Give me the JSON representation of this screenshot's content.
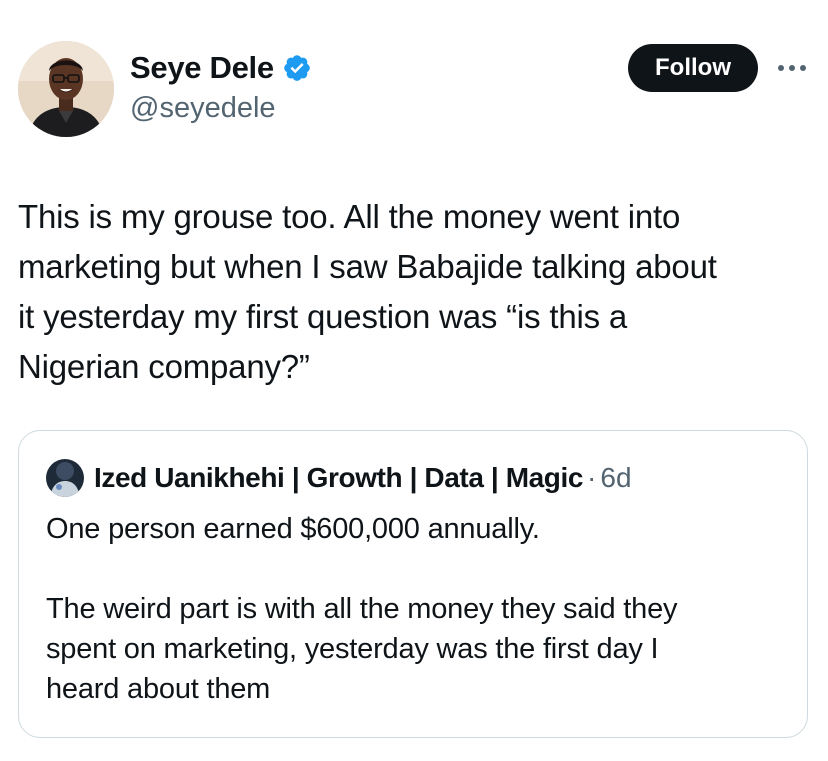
{
  "tweet": {
    "author": {
      "name": "Seye Dele",
      "handle": "@seyedele",
      "verified": true
    },
    "follow_label": "Follow",
    "more_icon": "more-horizontal-icon",
    "text": "This is my grouse too. All the money went into\nmarketing but when I saw Babajide talking about\nit yesterday my first question was “is this a\nNigerian company?”"
  },
  "quote": {
    "author_name": "Ized Uanikhehi | Growth | Data | Magic",
    "separator": "·",
    "time": "6d",
    "text": "One person earned $600,000 annually.\n\nThe weird part is with all the money they said they\nspent on marketing, yesterday was the first day I\nheard about them"
  },
  "colors": {
    "text_primary": "#0f1419",
    "text_secondary": "#536471",
    "verified_blue": "#1d9bf0",
    "border": "#cfd9de",
    "button_bg": "#0f1419"
  }
}
